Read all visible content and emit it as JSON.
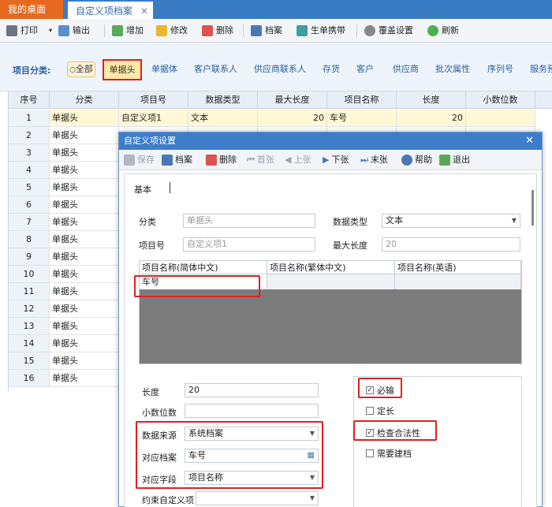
{
  "tabs": {
    "desk": "我的桌面",
    "custom": "自定义项档案"
  },
  "toolbar": {
    "print": "打印",
    "export": "输出",
    "add": "增加",
    "edit": "修改",
    "delete": "删除",
    "archive": "档案",
    "gen_carrier": "生单携带",
    "cover_settings": "覆盖设置",
    "refresh": "刷新"
  },
  "categories": {
    "label": "项目分类:",
    "all": "全部",
    "items": [
      "单据头",
      "单据体",
      "客户联系人",
      "供应商联系人",
      "存货",
      "客户",
      "供应商",
      "批次属性",
      "序列号",
      "服务预"
    ]
  },
  "grid": {
    "headers": [
      "序号",
      "分类",
      "项目号",
      "数据类型",
      "最大长度",
      "项目名称",
      "长度",
      "小数位数"
    ],
    "row1": {
      "no": "1",
      "cat": "单据头",
      "code": "自定义项1",
      "type": "文本",
      "maxlen": "20",
      "name": "车号",
      "len": "20"
    },
    "row_numbers": [
      "2",
      "3",
      "4",
      "5",
      "6",
      "7",
      "8",
      "9",
      "10",
      "11",
      "12",
      "13",
      "14",
      "15",
      "16"
    ],
    "row_cat": "单据头"
  },
  "dialog": {
    "title": "自定义项设置",
    "toolbar": {
      "save": "保存",
      "archive": "档案",
      "delete": "删除",
      "first": "首张",
      "prev": "上张",
      "next": "下张",
      "last": "末张",
      "help": "帮助",
      "exit": "退出"
    },
    "tab": "基本",
    "fields": {
      "cat_label": "分类",
      "cat_value": "单据头",
      "type_label": "数据类型",
      "type_value": "文本",
      "code_label": "项目号",
      "code_value": "自定义项1",
      "maxlen_label": "最大长度",
      "maxlen_value": "20"
    },
    "name_grid": {
      "headers": [
        "项目名称(简体中文)",
        "项目名称(繁体中文)",
        "项目名称(英语)"
      ],
      "value": "车号"
    },
    "lower": {
      "len_label": "长度",
      "len_value": "20",
      "dec_label": "小数位数",
      "src_label": "数据来源",
      "src_value": "系统档案",
      "arch_label": "对应档案",
      "arch_value": "车号",
      "field_label": "对应字段",
      "field_value": "项目名称",
      "constrain_label": "约束自定义项"
    },
    "checks": {
      "required": "必输",
      "fixed": "定长",
      "validate": "检查合法性",
      "need_archive": "需要建档"
    }
  },
  "colors": {
    "accent": "#3d7dca",
    "highlight": "#e02020",
    "tab_active": "#e6691f"
  }
}
